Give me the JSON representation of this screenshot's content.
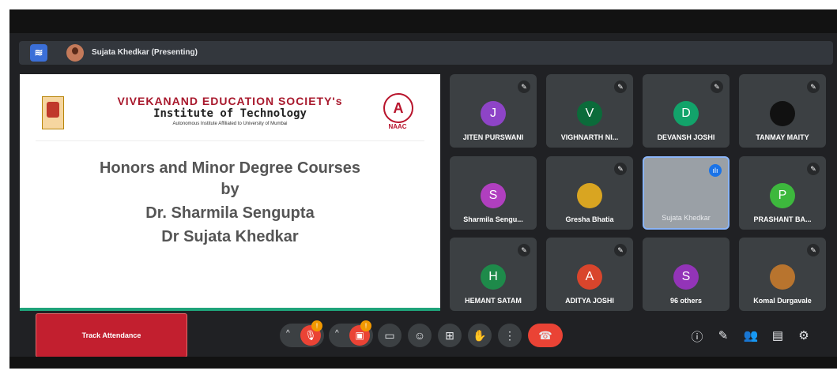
{
  "presenting": {
    "label": "Sujata Khedkar (Presenting)",
    "logo_glyph": "≋"
  },
  "slide": {
    "institution_line1": "VIVEKANAND EDUCATION SOCIETY's",
    "institution_line2": "Institute of Technology",
    "institution_line3": "Autonomous Institute Affiliated to University of Mumbai",
    "grade": "A",
    "naac": "NAAC",
    "title_lines": [
      "Honors and Minor Degree Courses",
      "by",
      "Dr. Sharmila Sengupta",
      "Dr Sujata Khedkar"
    ]
  },
  "participants": [
    {
      "name": "JITEN PURSWANI",
      "initial": "J",
      "color": "#8e44c7",
      "muted": true
    },
    {
      "name": "VIGHNARTH NI...",
      "initial": "V",
      "color": "#0b6b3a",
      "muted": true
    },
    {
      "name": "DEVANSH JOSHI",
      "initial": "D",
      "color": "#12a36a",
      "muted": true
    },
    {
      "name": "TANMAY MAITY",
      "initial": "",
      "color": "#111111",
      "muted": true
    },
    {
      "name": "Sharmila Sengu...",
      "initial": "S",
      "color": "#b03fbf",
      "muted": false
    },
    {
      "name": "Gresha Bhatia",
      "initial": "",
      "color": "#d9a521",
      "muted": true
    },
    {
      "name": "Sujata Khedkar",
      "initial": "",
      "color": "#9aa0a6",
      "muted": false,
      "speaking": true
    },
    {
      "name": "PRASHANT BA...",
      "initial": "P",
      "color": "#3db83d",
      "muted": true
    },
    {
      "name": "HEMANT SATAM",
      "initial": "H",
      "color": "#1e8a4a",
      "muted": true
    },
    {
      "name": "ADITYA JOSHI",
      "initial": "A",
      "color": "#d9452c",
      "muted": true
    },
    {
      "name": "96 others",
      "initial": "S",
      "color": "#9334b8",
      "muted": false
    },
    {
      "name": "Komal Durgavale",
      "initial": "",
      "color": "#b8742e",
      "muted": true
    }
  ],
  "controls": {
    "track_attendance": "Track Attendance",
    "mic_badge": "!",
    "cam_badge": "!"
  },
  "icons": {
    "mute": "✎",
    "speaking": "ılı",
    "chevron": "^",
    "captions": "▭",
    "emoji": "☺",
    "present": "⊞",
    "hand": "✋",
    "more": "⋮",
    "end": "☎",
    "info": "ⓘ",
    "activities": "✎",
    "people": "👥",
    "chat": "▤",
    "tools": "⚙"
  }
}
